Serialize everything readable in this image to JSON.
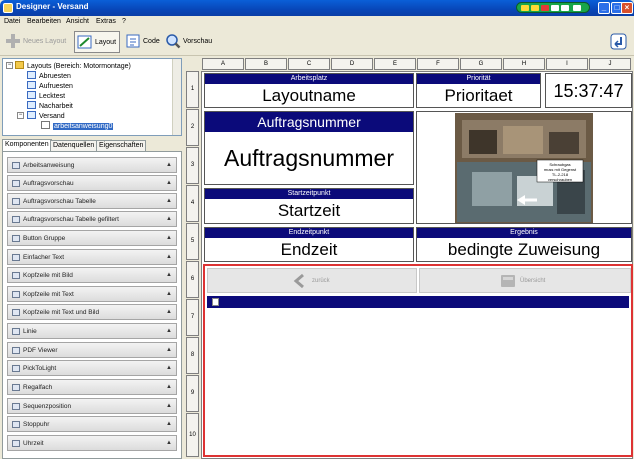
{
  "window": {
    "title": "Designer - Versand"
  },
  "menu": [
    "Datei",
    "Bearbeiten",
    "Ansicht",
    "Extras",
    "?"
  ],
  "toolbar": {
    "new_layout": "Neues Layout",
    "layout": "Layout",
    "code": "Code",
    "preview": "Vorschau"
  },
  "tree": {
    "root": "Layouts (Bereich: Motormontage)",
    "items": [
      "Abruesten",
      "Aufruesten",
      "Lecktest",
      "Nacharbeit",
      "Versand"
    ],
    "child": "arbeitsanweisung0"
  },
  "tabs": [
    "Komponenten",
    "Datenquellen",
    "Eigenschaften"
  ],
  "components": [
    "Arbeitsanweisung",
    "Auftragsvorschau",
    "Auftragsvorschau Tabelle",
    "Auftragsvorschau Tabelle gefiltert",
    "Button Gruppe",
    "Einfacher Text",
    "Kopfzeile mit Bild",
    "Kopfzeile mit Text",
    "Kopfzeile mit Text und Bild",
    "Linie",
    "PDF Viewer",
    "PickToLight",
    "Regalfach",
    "Sequenzposition",
    "Stoppuhr",
    "Uhrzeit"
  ],
  "grid": {
    "columns": [
      "A",
      "B",
      "C",
      "D",
      "E",
      "F",
      "G",
      "H",
      "I",
      "J"
    ],
    "rows": [
      "1",
      "2",
      "3",
      "4",
      "5",
      "6",
      "7",
      "8",
      "9",
      "10"
    ]
  },
  "widgets": {
    "arbeitsplatz": {
      "header": "Arbeitsplatz",
      "value": "Layoutname"
    },
    "prioritaet": {
      "header": "Priorität",
      "value": "Prioritaet"
    },
    "clock": {
      "value": "15:37:47"
    },
    "auftragsnummer": {
      "header": "Auftragsnummer",
      "value": "Auftragsnummer"
    },
    "startzeit": {
      "header": "Startzeitpunkt",
      "value": "Startzeit"
    },
    "endzeit": {
      "header": "Endzeitpunkt",
      "value": "Endzeit"
    },
    "ergebnis": {
      "header": "Ergebnis",
      "value": "bedingte Zuweisung"
    },
    "photo_note": "Schraubgas\nmuss mit Gegenst\nTL-2-218\nverschrauben"
  },
  "nav": {
    "back": "zurück",
    "overview": "Übersicht"
  },
  "colors": {
    "accent": "#0b0a7a",
    "titlebar": "#0a5fd8",
    "selection": "#316ac5",
    "border_red": "#d33333"
  }
}
